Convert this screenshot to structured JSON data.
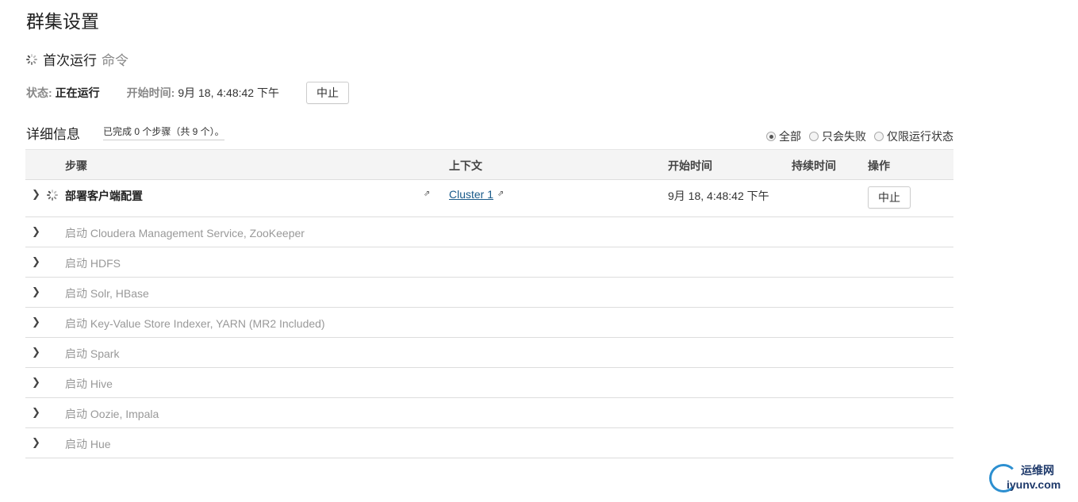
{
  "page": {
    "title": "群集设置"
  },
  "command": {
    "main": "首次运行",
    "sub": "命令"
  },
  "status": {
    "label": "状态:",
    "value": "正在运行",
    "start_label": "开始时间:",
    "start_value": "9月 18, 4:48:42 下午",
    "abort_label": "中止"
  },
  "details": {
    "title": "详细信息",
    "progress": "已完成 0 个步骤（共 9 个）。"
  },
  "filters": [
    {
      "label": "全部",
      "checked": true
    },
    {
      "label": "只会失败",
      "checked": false
    },
    {
      "label": "仅限运行状态",
      "checked": false
    }
  ],
  "table": {
    "headers": {
      "step": "步骤",
      "context": "上下文",
      "start": "开始时间",
      "duration": "持续时间",
      "actions": "操作"
    },
    "active_row": {
      "step": "部署客户端配置",
      "context": "Cluster 1",
      "start": "9月 18, 4:48:42 下午",
      "action": "中止"
    },
    "pending_rows": [
      "启动 Cloudera Management Service, ZooKeeper",
      "启动 HDFS",
      "启动 Solr, HBase",
      "启动 Key-Value Store Indexer, YARN (MR2 Included)",
      "启动 Spark",
      "启动 Hive",
      "启动 Oozie, Impala",
      "启动 Hue"
    ]
  },
  "watermark": {
    "line1": "运维网",
    "line2": "iyunv.com"
  },
  "icons": {
    "spinner": "loading-spinner-icon",
    "chevron": "chevron-right-icon",
    "external": "external-link-icon"
  }
}
